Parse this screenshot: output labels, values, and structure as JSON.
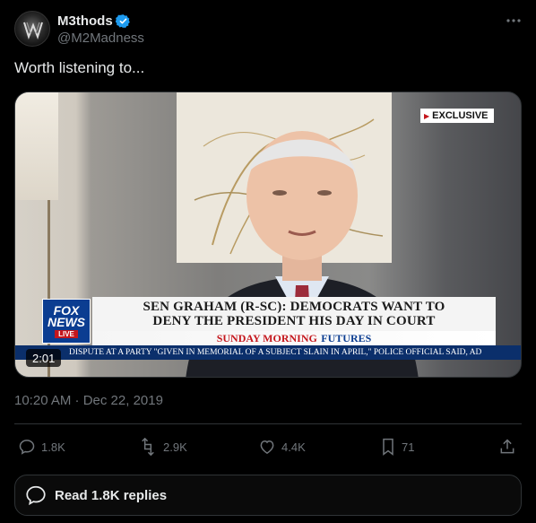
{
  "author": {
    "display_name": "M3thods",
    "handle": "@M2Madness",
    "verified_color": "#1d9bf0"
  },
  "tweet": {
    "text": "Worth listening to...",
    "timestamp": "10:20 AM · Dec 22, 2019"
  },
  "video": {
    "badge": "EXCLUSIVE",
    "duration": "2:01",
    "logo_top": "FOX",
    "logo_mid": "NEWS",
    "logo_live": "LIVE",
    "headline_line1": "SEN GRAHAM (R-SC): DEMOCRATS WANT TO",
    "headline_line2": "DENY THE PRESIDENT HIS DAY IN COURT",
    "program_part1": "SUNDAY MORNING",
    "program_part2": "FUTURES",
    "ticker": "DISPUTE AT A PARTY \"GIVEN IN MEMORIAL OF A SUBJECT SLAIN IN APRIL,\" POLICE OFFICIAL SAID, AD"
  },
  "actions": {
    "replies": "1.8K",
    "reposts": "2.9K",
    "likes": "4.4K",
    "bookmarks": "71"
  },
  "read_replies": "Read 1.8K replies",
  "icons": [
    "more-icon",
    "verified-icon",
    "reply-icon",
    "repost-icon",
    "like-icon",
    "bookmark-icon",
    "share-icon",
    "speech-bubble-icon"
  ]
}
